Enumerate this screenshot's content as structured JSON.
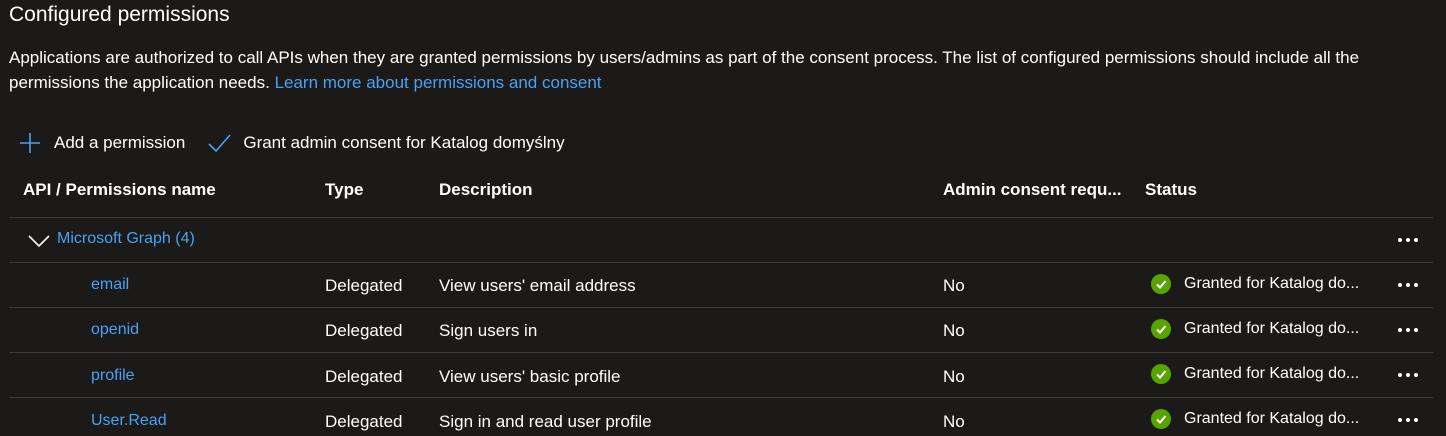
{
  "title": "Configured permissions",
  "description": {
    "text": "Applications are authorized to call APIs when they are granted permissions by users/admins as part of the consent process. The list of configured permissions should include all the permissions the application needs.",
    "link": "Learn more about permissions and consent"
  },
  "toolbar": {
    "add_label": "Add a permission",
    "grant_label": "Grant admin consent for Katalog domyślny"
  },
  "columns": {
    "api": "API / Permissions name",
    "type": "Type",
    "description": "Description",
    "admin": "Admin consent requ...",
    "status": "Status"
  },
  "group": {
    "label": "Microsoft Graph (4)"
  },
  "rows": [
    {
      "name": "email",
      "type": "Delegated",
      "description": "View users' email address",
      "admin": "No",
      "status": "Granted for Katalog do..."
    },
    {
      "name": "openid",
      "type": "Delegated",
      "description": "Sign users in",
      "admin": "No",
      "status": "Granted for Katalog do..."
    },
    {
      "name": "profile",
      "type": "Delegated",
      "description": "View users' basic profile",
      "admin": "No",
      "status": "Granted for Katalog do..."
    },
    {
      "name": "User.Read",
      "type": "Delegated",
      "description": "Sign in and read user profile",
      "admin": "No",
      "status": "Granted for Katalog do..."
    }
  ],
  "colors": {
    "link": "#4aa0f2",
    "granted": "#57a300",
    "background": "#1b1a19"
  }
}
